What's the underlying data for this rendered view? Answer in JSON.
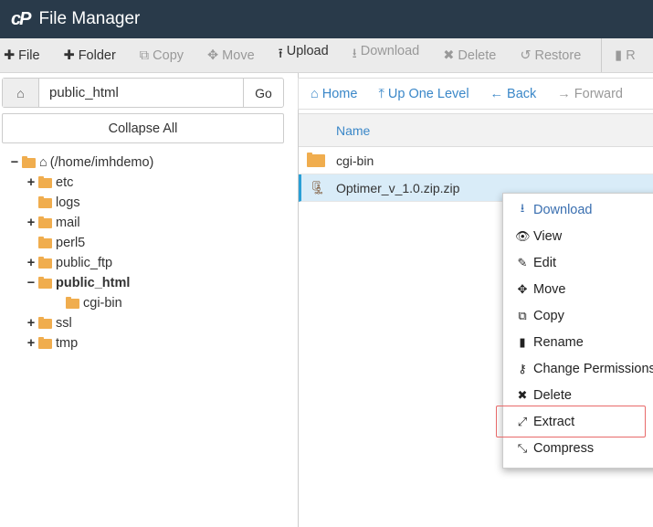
{
  "header": {
    "logo": "cP",
    "title": "File Manager"
  },
  "toolbar": [
    {
      "label": "File",
      "icon": "plus-icon",
      "glyph": "✚",
      "enabled": true
    },
    {
      "label": "Folder",
      "icon": "plus-icon",
      "glyph": "✚",
      "enabled": true
    },
    {
      "label": "Copy",
      "icon": "copy-icon",
      "glyph": "⧉",
      "enabled": false
    },
    {
      "label": "Move",
      "icon": "move-icon",
      "glyph": "✥",
      "enabled": false
    },
    {
      "label": "Upload",
      "icon": "upload-icon",
      "glyph": "⭱",
      "enabled": true
    },
    {
      "label": "Download",
      "icon": "download-icon",
      "glyph": "⭳",
      "enabled": false
    },
    {
      "label": "Delete",
      "icon": "close-icon",
      "glyph": "✖",
      "enabled": false
    },
    {
      "label": "Restore",
      "icon": "undo-icon",
      "glyph": "↺",
      "enabled": false
    },
    {
      "label": "R",
      "icon": "file-icon",
      "glyph": "▮",
      "enabled": false
    }
  ],
  "path": {
    "value": "public_html",
    "go": "Go"
  },
  "collapse_all": "Collapse All",
  "tree": [
    {
      "label": "(/home/imhdemo)",
      "toggle": "−",
      "depth": 0,
      "open": true,
      "home": true
    },
    {
      "label": "etc",
      "toggle": "+",
      "depth": 1
    },
    {
      "label": "logs",
      "toggle": "",
      "depth": 1
    },
    {
      "label": "mail",
      "toggle": "+",
      "depth": 1
    },
    {
      "label": "perl5",
      "toggle": "",
      "depth": 1
    },
    {
      "label": "public_ftp",
      "toggle": "+",
      "depth": 1
    },
    {
      "label": "public_html",
      "toggle": "−",
      "depth": 1,
      "open": true,
      "bold": true
    },
    {
      "label": "cgi-bin",
      "toggle": "",
      "depth": 2
    },
    {
      "label": "ssl",
      "toggle": "+",
      "depth": 1
    },
    {
      "label": "tmp",
      "toggle": "+",
      "depth": 1
    }
  ],
  "nav": [
    {
      "label": "Home",
      "glyph": "⌂",
      "enabled": true
    },
    {
      "label": "Up One Level",
      "glyph": "⤒",
      "enabled": true
    },
    {
      "label": "Back",
      "glyph": "←",
      "enabled": true
    },
    {
      "label": "Forward",
      "glyph": "→",
      "enabled": false
    }
  ],
  "table": {
    "header": "Name",
    "rows": [
      {
        "name": "cgi-bin",
        "type": "folder"
      },
      {
        "name": "Optimer_v_1.0.zip.zip",
        "type": "zip",
        "selected": true
      }
    ]
  },
  "context_menu": [
    {
      "label": "Download",
      "glyph": "⭳",
      "icon": "download-icon"
    },
    {
      "label": "View",
      "glyph": "👁",
      "icon": "eye-icon"
    },
    {
      "label": "Edit",
      "glyph": "✎",
      "icon": "pencil-icon"
    },
    {
      "label": "Move",
      "glyph": "✥",
      "icon": "move-icon"
    },
    {
      "label": "Copy",
      "glyph": "⧉",
      "icon": "copy-icon"
    },
    {
      "label": "Rename",
      "glyph": "▮",
      "icon": "file-icon"
    },
    {
      "label": "Change Permissions",
      "glyph": "⚷",
      "icon": "key-icon"
    },
    {
      "label": "Delete",
      "glyph": "✖",
      "icon": "close-icon"
    },
    {
      "label": "Extract",
      "glyph": "⤢",
      "icon": "expand-icon",
      "highlighted": true
    },
    {
      "label": "Compress",
      "glyph": "⤡",
      "icon": "compress-icon"
    }
  ],
  "colors": {
    "header": "#293a4a",
    "accent": "#3a87c8",
    "folder": "#f0ad4e",
    "selected_row": "#d9ecf8",
    "highlight_box": "#e86a6a"
  }
}
